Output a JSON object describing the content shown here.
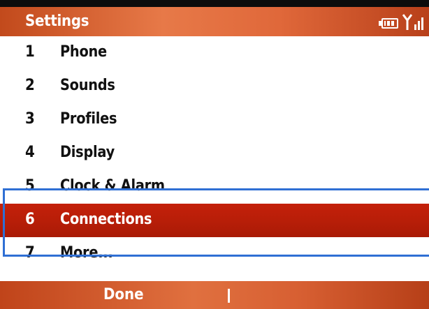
{
  "header": {
    "title": "Settings",
    "status_icons": [
      "battery-icon",
      "signal-strength-icon"
    ]
  },
  "menu": {
    "items": [
      {
        "number": "1",
        "label": "Phone"
      },
      {
        "number": "2",
        "label": "Sounds"
      },
      {
        "number": "3",
        "label": "Profiles"
      },
      {
        "number": "4",
        "label": "Display"
      },
      {
        "number": "5",
        "label": "Clock & Alarm"
      },
      {
        "number": "6",
        "label": "Connections",
        "selected": true
      },
      {
        "number": "7",
        "label": "More..."
      }
    ]
  },
  "softkeys": {
    "left": "Done"
  },
  "colors": {
    "accent": "#e0703f",
    "selection": "#b81e08",
    "focus_outline": "#2f6fd4",
    "text": "#111111"
  }
}
